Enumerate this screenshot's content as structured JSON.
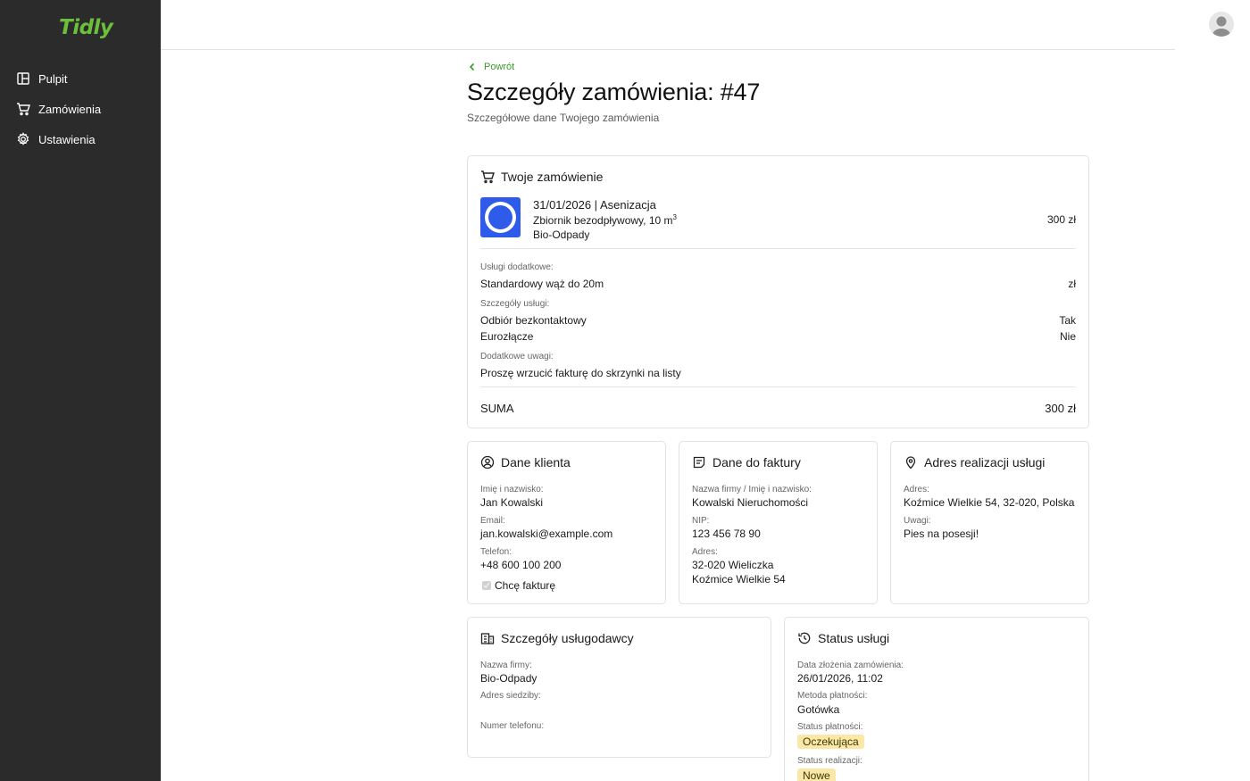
{
  "app": {
    "logo": "Tidly"
  },
  "sidebar": {
    "items": [
      {
        "label": "Pulpit",
        "icon": "dashboard-icon"
      },
      {
        "label": "Zamówienia",
        "icon": "cart-icon"
      },
      {
        "label": "Ustawienia",
        "icon": "gear-icon"
      }
    ]
  },
  "header": {
    "back_label": "Powrót",
    "title": "Szczegóły zamówienia: #47",
    "subtitle": "Szczegółowe dane Twojego zamówienia"
  },
  "order": {
    "title": "Twoje zamówienie",
    "date_service": "31/01/2026 | Asenizacja",
    "tank": "Zbiornik bezodpływowy, 10 m",
    "tank_sup": "3",
    "provider": "Bio-Odpady",
    "price": "300 zł",
    "extra_services_label": "Usługi dodatkowe:",
    "extra_service": "Standardowy wąż do 20m",
    "extra_service_price": "zł",
    "details_label": "Szczegóły usługi:",
    "detail_rows": [
      {
        "name": "Odbiór bezkontaktowy",
        "value": "Tak"
      },
      {
        "name": "Eurozłącze",
        "value": "Nie"
      }
    ],
    "notes_label": "Dodatkowe uwagi:",
    "notes": "Proszę wrzucić fakturę do skrzynki na listy",
    "sum_label": "SUMA",
    "sum_value": "300 zł"
  },
  "client": {
    "title": "Dane klienta",
    "name_label": "Imię i nazwisko:",
    "name": "Jan Kowalski",
    "email_label": "Email:",
    "email": "jan.kowalski@example.com",
    "phone_label": "Telefon:",
    "phone": "+48 600 100 200",
    "invoice_checkbox_label": "Chcę fakturę",
    "invoice_checked": true
  },
  "invoice": {
    "title": "Dane do faktury",
    "company_label": "Nazwa firmy / Imię i nazwisko:",
    "company": "Kowalski Nieruchomości",
    "nip_label": "NIP:",
    "nip": "123 456 78 90",
    "address_label": "Adres:",
    "address_line1": "32-020 Wieliczka",
    "address_line2": "Koźmice Wielkie 54"
  },
  "location": {
    "title": "Adres realizacji usługi",
    "address_label": "Adres:",
    "address": "Koźmice Wielkie 54, 32-020, Polska",
    "notes_label": "Uwagi:",
    "notes": "Pies na posesji!"
  },
  "provider_details": {
    "title": "Szczegóły usługodawcy",
    "name_label": "Nazwa firmy:",
    "name": "Bio-Odpady",
    "address_label": "Adres siedziby:",
    "phone_label": "Numer telefonu:"
  },
  "status": {
    "title": "Status usługi",
    "created_label": "Data złożenia zamówienia:",
    "created": "26/01/2026, 11:02",
    "payment_method_label": "Metoda płatności:",
    "payment_method": "Gotówka",
    "payment_status_label": "Status płatności:",
    "payment_status": "Oczekująca",
    "fulfillment_label": "Status realizacji:",
    "fulfillment": "Nowe"
  },
  "colors": {
    "sidebar_bg": "#2b2b2b",
    "accent_green": "#6bbf3a",
    "badge_yellow": "#fbe7a8",
    "provider_logo_blue": "#2f5bea"
  }
}
